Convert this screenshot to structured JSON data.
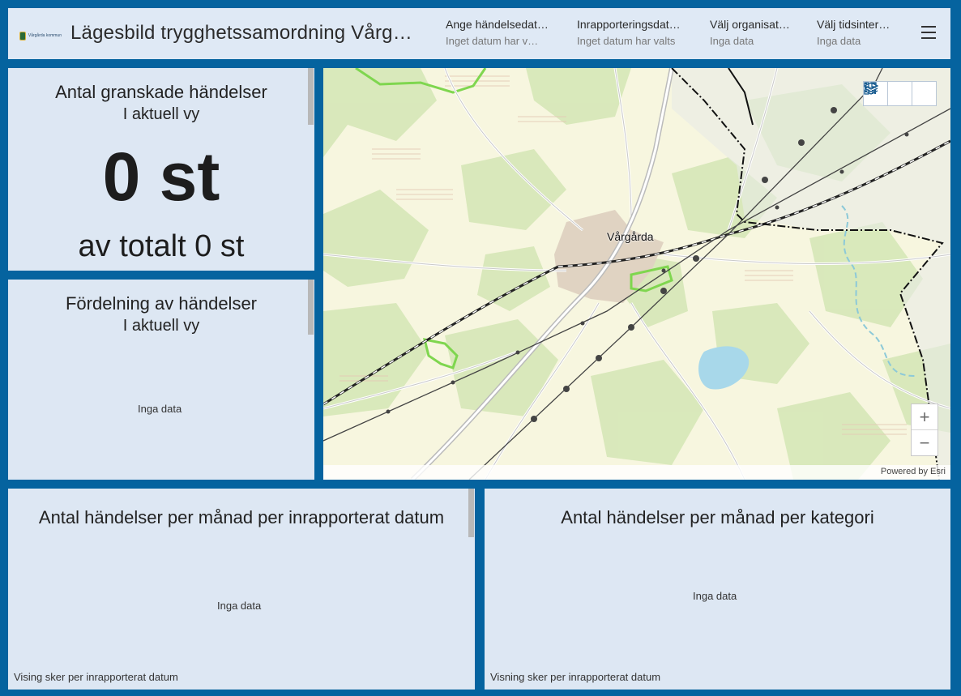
{
  "header": {
    "logo_text": "Vårgårda kommun",
    "title": "Lägesbild trygghetssamordning Vårg…",
    "filters": [
      {
        "label": "Ange händelsedat…",
        "value": "Inget datum har v…"
      },
      {
        "label": "Inrapporteringsdat…",
        "value": "Inget datum har valts"
      },
      {
        "label": "Välj organisat…",
        "value": "Inga data"
      },
      {
        "label": "Välj tidsinter…",
        "value": "Inga data"
      }
    ]
  },
  "indicator": {
    "title": "Antal granskade händelser",
    "subtitle": "I aktuell vy",
    "value": "0 st",
    "total": "av totalt 0 st"
  },
  "pie_panel": {
    "title": "Fördelning av händelser",
    "subtitle": "I aktuell vy",
    "no_data": "Inga data"
  },
  "map": {
    "town_label": "Vårgårda",
    "attribution": "Powered by Esri",
    "zoom_in": "+",
    "zoom_out": "−",
    "tools": [
      "legend-icon",
      "layers-icon",
      "qr-code-icon"
    ]
  },
  "bottom_left": {
    "title": "Antal händelser per månad per inrapporterat datum",
    "no_data": "Inga data",
    "footnote": "Vising sker per inrapporterat datum"
  },
  "bottom_right": {
    "title": "Antal händelser per månad per kategori",
    "no_data": "Inga data",
    "footnote": "Visning sker per inrapporterat datum"
  },
  "colors": {
    "frame": "#05639f",
    "panel": "#dde7f3",
    "map_base": "#f7f6df",
    "water": "#a8d8ea",
    "protected_area": "#7fd64f"
  }
}
